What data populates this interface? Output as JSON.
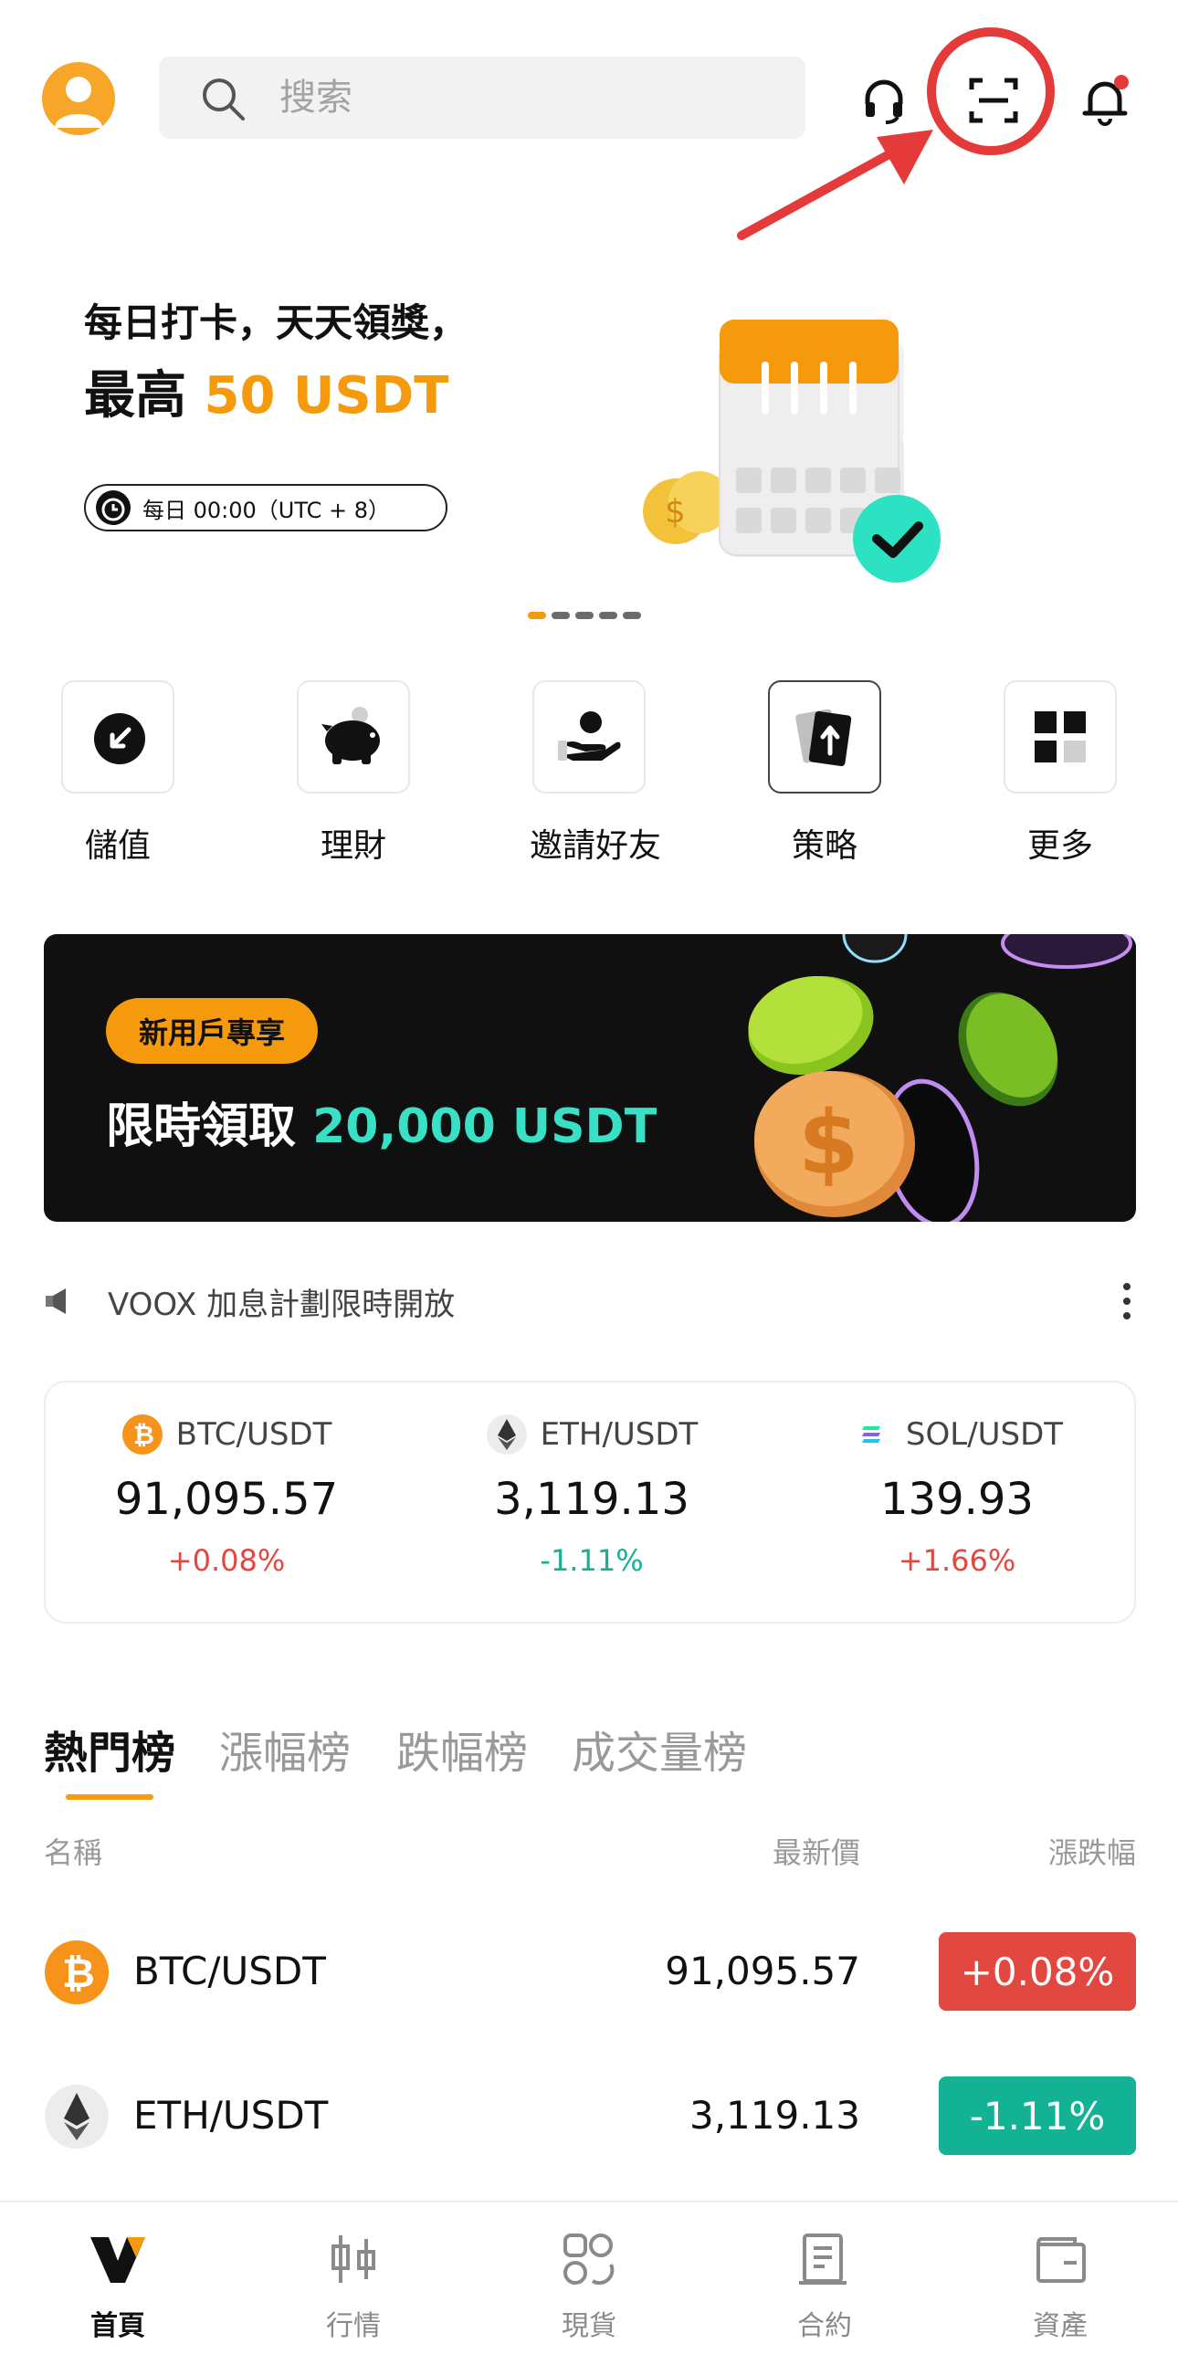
{
  "header": {
    "search_placeholder": "搜索"
  },
  "banner": {
    "line1": "每日打卡，天天領獎，",
    "line2_prefix": "最高 ",
    "line2_accent": "50 USDT",
    "pill_text": "每日 00:00（UTC + 8）",
    "slide_count": 5,
    "active_slide": 1
  },
  "quick_actions": [
    {
      "label": "儲值",
      "icon": "deposit-icon"
    },
    {
      "label": "理財",
      "icon": "piggy-bank-icon"
    },
    {
      "label": "邀請好友",
      "icon": "invite-icon"
    },
    {
      "label": "策略",
      "icon": "strategy-icon"
    },
    {
      "label": "更多",
      "icon": "more-grid-icon"
    }
  ],
  "promo": {
    "tag": "新用戶專享",
    "title_prefix": "限時領取 ",
    "title_accent": "20,000 USDT"
  },
  "notice": {
    "text": "VOOX 加息計劃限時開放"
  },
  "tickers": [
    {
      "pair": "BTC/USDT",
      "price": "91,095.57",
      "change": "+0.08%",
      "direction": "up"
    },
    {
      "pair": "ETH/USDT",
      "price": "3,119.13",
      "change": "-1.11%",
      "direction": "down"
    },
    {
      "pair": "SOL/USDT",
      "price": "139.93",
      "change": "+1.66%",
      "direction": "up"
    }
  ],
  "rank_tabs": [
    "熱門榜",
    "漲幅榜",
    "跌幅榜",
    "成交量榜"
  ],
  "columns": {
    "name": "名稱",
    "price": "最新價",
    "change": "漲跌幅"
  },
  "rows": [
    {
      "pair": "BTC/USDT",
      "price": "91,095.57",
      "change": "+0.08%",
      "direction": "up"
    },
    {
      "pair": "ETH/USDT",
      "price": "3,119.13",
      "change": "-1.11%",
      "direction": "down"
    }
  ],
  "bottom_nav": [
    {
      "label": "首頁",
      "icon": "home-logo-icon",
      "active": true
    },
    {
      "label": "行情",
      "icon": "market-candles-icon",
      "active": false
    },
    {
      "label": "現貨",
      "icon": "spot-icon",
      "active": false
    },
    {
      "label": "合約",
      "icon": "contract-icon",
      "active": false
    },
    {
      "label": "資產",
      "icon": "wallet-icon",
      "active": false
    }
  ],
  "colors": {
    "accent": "#f59a0c",
    "up": "#e2483f",
    "down": "#13b294",
    "promo_accent": "#38e0c6",
    "highlight": "#e53a3a"
  }
}
